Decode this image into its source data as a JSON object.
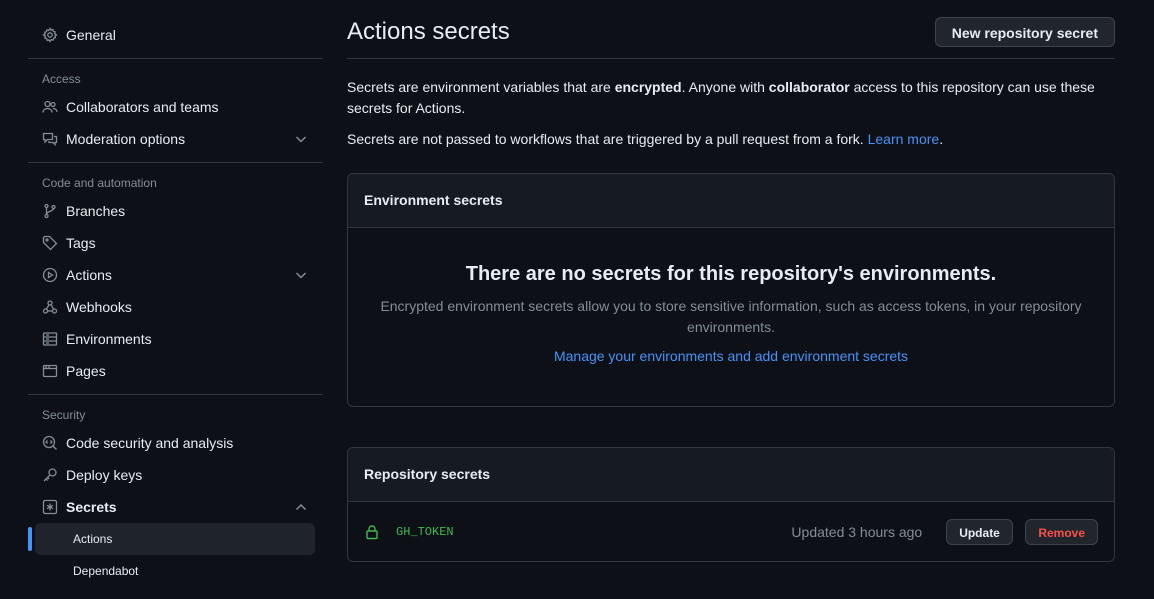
{
  "sidebar": {
    "general": "General",
    "sections": {
      "access": "Access",
      "code": "Code and automation",
      "security": "Security"
    },
    "items": {
      "collaborators": "Collaborators and teams",
      "moderation": "Moderation options",
      "branches": "Branches",
      "tags": "Tags",
      "actions": "Actions",
      "webhooks": "Webhooks",
      "environments": "Environments",
      "pages": "Pages",
      "code_security": "Code security and analysis",
      "deploy_keys": "Deploy keys",
      "secrets": "Secrets"
    },
    "secrets_sub": {
      "actions": "Actions",
      "dependabot": "Dependabot"
    }
  },
  "main": {
    "title": "Actions secrets",
    "new_secret_button": "New repository secret",
    "desc": {
      "p1_a": "Secrets are environment variables that are ",
      "p1_b": "encrypted",
      "p1_c": ". Anyone with ",
      "p1_d": "collaborator",
      "p1_e": " access to this repository can use these secrets for Actions.",
      "p2_a": "Secrets are not passed to workflows that are triggered by a pull request from a fork. ",
      "p2_link": "Learn more",
      "p2_end": "."
    },
    "env_box": {
      "header": "Environment secrets",
      "blank_title": "There are no secrets for this repository's environments.",
      "blank_text": "Encrypted environment secrets allow you to store sensitive information, such as access tokens, in your repository environments.",
      "blank_link": "Manage your environments and add environment secrets"
    },
    "repo_box": {
      "header": "Repository secrets",
      "secrets": [
        {
          "name": "GH_TOKEN",
          "updated": "Updated 3 hours ago",
          "update_label": "Update",
          "remove_label": "Remove"
        }
      ]
    }
  },
  "colors": {
    "background": "#0d1117",
    "accent": "#4493f8",
    "success": "#3fb950",
    "danger": "#f85149",
    "border": "#30363d"
  },
  "icons": {
    "general": "gear-icon",
    "collaborators": "people-icon",
    "moderation": "comment-discussion-icon",
    "branches": "git-branch-icon",
    "tags": "tag-icon",
    "actions": "play-icon",
    "webhooks": "webhook-icon",
    "environments": "server-icon",
    "pages": "browser-icon",
    "code_security": "codescan-icon",
    "deploy_keys": "key-icon",
    "secrets": "key-asterisk-icon",
    "secret_row": "lock-icon"
  }
}
